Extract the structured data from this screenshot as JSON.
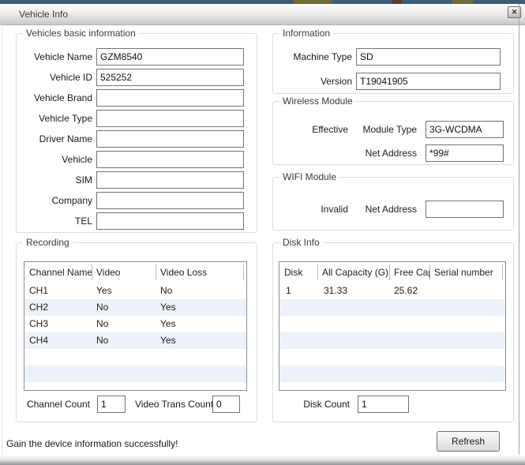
{
  "dialog": {
    "title": "Vehicle Info",
    "close_glyph": "✕"
  },
  "basic_info": {
    "title": "Vehicles basic information",
    "fields": [
      {
        "label": "Vehicle Name",
        "value": "GZM8540"
      },
      {
        "label": "Vehicle ID",
        "value": "525252"
      },
      {
        "label": "Vehicle Brand",
        "value": ""
      },
      {
        "label": "Vehicle Type",
        "value": ""
      },
      {
        "label": "Driver Name",
        "value": ""
      },
      {
        "label": "Vehicle",
        "value": ""
      },
      {
        "label": "SIM",
        "value": ""
      },
      {
        "label": "Company",
        "value": ""
      },
      {
        "label": "TEL",
        "value": ""
      }
    ]
  },
  "information": {
    "title": "Information",
    "fields": [
      {
        "label": "Machine Type",
        "value": "SD"
      },
      {
        "label": "Version",
        "value": "T19041905"
      }
    ]
  },
  "wireless_module": {
    "title": "Wireless Module",
    "status": "Effective",
    "fields": [
      {
        "label": "Module Type",
        "value": "3G-WCDMA"
      },
      {
        "label": "Net Address",
        "value": "*99#"
      }
    ]
  },
  "wifi_module": {
    "title": "WIFI Module",
    "status": "Invalid",
    "fields": [
      {
        "label": "Net Address",
        "value": ""
      }
    ]
  },
  "recording": {
    "title": "Recording",
    "table": {
      "columns": [
        "Channel Name",
        "Video",
        "Video Loss"
      ],
      "rows": [
        [
          "CH1",
          "Yes",
          "No"
        ],
        [
          "CH2",
          "No",
          "Yes"
        ],
        [
          "CH3",
          "No",
          "Yes"
        ],
        [
          "CH4",
          "No",
          "Yes"
        ]
      ]
    },
    "channel_count": {
      "label": "Channel Count",
      "value": "1"
    },
    "video_trans_count": {
      "label": "Video Trans Count",
      "value": "0"
    }
  },
  "disk_info": {
    "title": "Disk Info",
    "table": {
      "columns": [
        "Disk",
        "All Capacity (G)",
        "Free Cap",
        "Serial number"
      ],
      "rows": [
        [
          "1",
          "31.33",
          "25.62",
          ""
        ]
      ]
    },
    "disk_count": {
      "label": "Disk Count",
      "value": "1"
    }
  },
  "footer": {
    "status_text": "Gain the device information successfully!",
    "refresh_label": "Refresh"
  }
}
